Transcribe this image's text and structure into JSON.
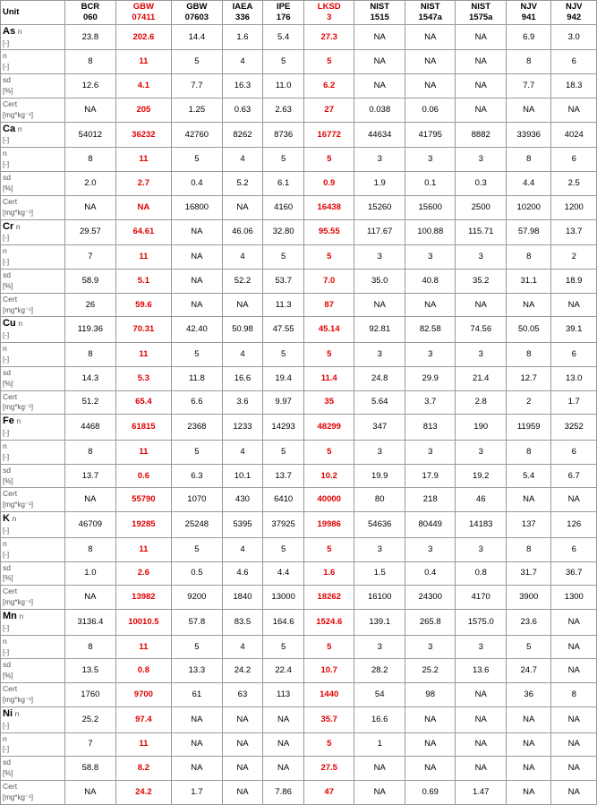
{
  "columns": [
    {
      "id": "unit",
      "label1": "",
      "label2": "Unit",
      "class": "col-unit"
    },
    {
      "id": "bcr060",
      "label1": "BCR",
      "label2": "060",
      "class": "col-bcr"
    },
    {
      "id": "gbw07411",
      "label1": "GBW",
      "label2": "07411",
      "class": "col-gbw1",
      "red": true
    },
    {
      "id": "gbw07603",
      "label1": "GBW",
      "label2": "07603",
      "class": "col-gbw2"
    },
    {
      "id": "iaea336",
      "label1": "IAEA",
      "label2": "336",
      "class": "col-iaea"
    },
    {
      "id": "ipe176",
      "label1": "IPE",
      "label2": "176",
      "class": "col-ipe"
    },
    {
      "id": "lksd3",
      "label1": "LKSD",
      "label2": "3",
      "class": "col-lksd",
      "red": true
    },
    {
      "id": "nist1515",
      "label1": "NIST",
      "label2": "1515",
      "class": "col-nist1"
    },
    {
      "id": "nist1547a",
      "label1": "NIST",
      "label2": "1547a",
      "class": "col-nist2"
    },
    {
      "id": "nist1575a",
      "label1": "NIST",
      "label2": "1575a",
      "class": "col-nist3"
    },
    {
      "id": "njv941",
      "label1": "NJV",
      "label2": "941",
      "class": "col-njv1"
    },
    {
      "id": "njv942",
      "label1": "NJV",
      "label2": "942",
      "class": "col-njv2"
    }
  ],
  "elements": [
    {
      "name": "As",
      "rows": [
        {
          "label": "n",
          "unit": "[-]",
          "values": [
            "23.8",
            "202.6",
            "14.4",
            "1.6",
            "5.4",
            "27.3",
            "NA",
            "NA",
            "NA",
            "6.9",
            "3.0"
          ],
          "redCols": [
            1,
            5
          ]
        },
        {
          "label": "n",
          "unit": "[-]",
          "values": [
            "8",
            "11",
            "5",
            "4",
            "5",
            "5",
            "NA",
            "NA",
            "NA",
            "8",
            "6"
          ],
          "redCols": [
            1,
            5
          ]
        },
        {
          "label": "sd",
          "unit": "[%]",
          "values": [
            "12.6",
            "4.1",
            "7.7",
            "16.3",
            "11.0",
            "6.2",
            "NA",
            "NA",
            "NA",
            "7.7",
            "18.3"
          ],
          "redCols": [
            1,
            5
          ]
        },
        {
          "label": "Cert",
          "unit": "[mg*kg⁻¹]",
          "values": [
            "NA",
            "205",
            "1.25",
            "0.63",
            "2.63",
            "27",
            "0.038",
            "0.06",
            "NA",
            "NA",
            "NA"
          ],
          "redCols": [
            1,
            5
          ]
        }
      ]
    },
    {
      "name": "Ca",
      "rows": [
        {
          "label": "n",
          "unit": "[-]",
          "values": [
            "54012",
            "36232",
            "42760",
            "8262",
            "8736",
            "16772",
            "44634",
            "41795",
            "8882",
            "33936",
            "4024"
          ],
          "redCols": [
            1,
            5
          ]
        },
        {
          "label": "n",
          "unit": "[-]",
          "values": [
            "8",
            "11",
            "5",
            "4",
            "5",
            "5",
            "3",
            "3",
            "3",
            "8",
            "6"
          ],
          "redCols": [
            1,
            5
          ]
        },
        {
          "label": "sd",
          "unit": "[%]",
          "values": [
            "2.0",
            "2.7",
            "0.4",
            "5.2",
            "6.1",
            "0.9",
            "1.9",
            "0.1",
            "0.3",
            "4.4",
            "2.5"
          ],
          "redCols": [
            1,
            5
          ]
        },
        {
          "label": "Cert",
          "unit": "[mg*kg⁻¹]",
          "values": [
            "NA",
            "NA",
            "16800",
            "NA",
            "4160",
            "16438",
            "15260",
            "15600",
            "2500",
            "10200",
            "1200"
          ],
          "redCols": [
            1,
            5
          ]
        }
      ]
    },
    {
      "name": "Cr",
      "rows": [
        {
          "label": "n",
          "unit": "[-]",
          "values": [
            "29.57",
            "64.61",
            "NA",
            "46.06",
            "32.80",
            "95.55",
            "117.67",
            "100.88",
            "115.71",
            "57.98",
            "13.7"
          ],
          "redCols": [
            1,
            5
          ]
        },
        {
          "label": "n",
          "unit": "[-]",
          "values": [
            "7",
            "11",
            "NA",
            "4",
            "5",
            "5",
            "3",
            "3",
            "3",
            "8",
            "2"
          ],
          "redCols": [
            1,
            5
          ]
        },
        {
          "label": "sd",
          "unit": "[%]",
          "values": [
            "58.9",
            "5.1",
            "NA",
            "52.2",
            "53.7",
            "7.0",
            "35.0",
            "40.8",
            "35.2",
            "31.1",
            "18.9"
          ],
          "redCols": [
            1,
            5
          ]
        },
        {
          "label": "Cert",
          "unit": "[mg*kg⁻¹]",
          "values": [
            "26",
            "59.6",
            "NA",
            "NA",
            "11.3",
            "87",
            "NA",
            "NA",
            "NA",
            "NA",
            "NA"
          ],
          "redCols": [
            1,
            5
          ]
        }
      ]
    },
    {
      "name": "Cu",
      "rows": [
        {
          "label": "n",
          "unit": "[-]",
          "values": [
            "119.36",
            "70.31",
            "42.40",
            "50.98",
            "47.55",
            "45.14",
            "92.81",
            "82.58",
            "74.56",
            "50.05",
            "39.1"
          ],
          "redCols": [
            1,
            5
          ]
        },
        {
          "label": "n",
          "unit": "[-]",
          "values": [
            "8",
            "11",
            "5",
            "4",
            "5",
            "5",
            "3",
            "3",
            "3",
            "8",
            "6"
          ],
          "redCols": [
            1,
            5
          ]
        },
        {
          "label": "sd",
          "unit": "[%]",
          "values": [
            "14.3",
            "5.3",
            "11.8",
            "16.6",
            "19.4",
            "11.4",
            "24.8",
            "29.9",
            "21.4",
            "12.7",
            "13.0"
          ],
          "redCols": [
            1,
            5
          ]
        },
        {
          "label": "Cert",
          "unit": "[mg*kg⁻¹]",
          "values": [
            "51.2",
            "65.4",
            "6.6",
            "3.6",
            "9.97",
            "35",
            "5.64",
            "3.7",
            "2.8",
            "2",
            "1.7"
          ],
          "redCols": [
            1,
            5
          ]
        }
      ]
    },
    {
      "name": "Fe",
      "rows": [
        {
          "label": "n",
          "unit": "[-]",
          "values": [
            "4468",
            "61815",
            "2368",
            "1233",
            "14293",
            "48299",
            "347",
            "813",
            "190",
            "11959",
            "3252"
          ],
          "redCols": [
            1,
            5
          ]
        },
        {
          "label": "n",
          "unit": "[-]",
          "values": [
            "8",
            "11",
            "5",
            "4",
            "5",
            "5",
            "3",
            "3",
            "3",
            "8",
            "6"
          ],
          "redCols": [
            1,
            5
          ]
        },
        {
          "label": "sd",
          "unit": "[%]",
          "values": [
            "13.7",
            "0.6",
            "6.3",
            "10.1",
            "13.7",
            "10.2",
            "19.9",
            "17.9",
            "19.2",
            "5.4",
            "6.7"
          ],
          "redCols": [
            1,
            5
          ]
        },
        {
          "label": "Cert",
          "unit": "[mg*kg⁻¹]",
          "values": [
            "NA",
            "55790",
            "1070",
            "430",
            "6410",
            "40000",
            "80",
            "218",
            "46",
            "NA",
            "NA"
          ],
          "redCols": [
            1,
            5
          ]
        }
      ]
    },
    {
      "name": "K",
      "rows": [
        {
          "label": "n",
          "unit": "[-]",
          "values": [
            "46709",
            "19285",
            "25248",
            "5395",
            "37925",
            "19986",
            "54636",
            "80449",
            "14183",
            "137",
            "126"
          ],
          "redCols": [
            1,
            5
          ]
        },
        {
          "label": "n",
          "unit": "[-]",
          "values": [
            "8",
            "11",
            "5",
            "4",
            "5",
            "5",
            "3",
            "3",
            "3",
            "8",
            "6"
          ],
          "redCols": [
            1,
            5
          ]
        },
        {
          "label": "sd",
          "unit": "[%]",
          "values": [
            "1.0",
            "2.6",
            "0.5",
            "4.6",
            "4.4",
            "1.6",
            "1.5",
            "0.4",
            "0.8",
            "31.7",
            "36.7"
          ],
          "redCols": [
            1,
            5
          ]
        },
        {
          "label": "Cert",
          "unit": "[mg*kg⁻¹]",
          "values": [
            "NA",
            "13982",
            "9200",
            "1840",
            "13000",
            "18262",
            "16100",
            "24300",
            "4170",
            "3900",
            "1300"
          ],
          "redCols": [
            1,
            5
          ]
        }
      ]
    },
    {
      "name": "Mn",
      "rows": [
        {
          "label": "n",
          "unit": "[-]",
          "values": [
            "3136.4",
            "10010.5",
            "57.8",
            "83.5",
            "164.6",
            "1524.6",
            "139.1",
            "265.8",
            "1575.0",
            "23.6",
            "NA"
          ],
          "redCols": [
            1,
            5
          ]
        },
        {
          "label": "n",
          "unit": "[-]",
          "values": [
            "8",
            "11",
            "5",
            "4",
            "5",
            "5",
            "3",
            "3",
            "3",
            "5",
            "NA"
          ],
          "redCols": [
            1,
            5
          ]
        },
        {
          "label": "sd",
          "unit": "[%]",
          "values": [
            "13.5",
            "0.8",
            "13.3",
            "24.2",
            "22.4",
            "10.7",
            "28.2",
            "25.2",
            "13.6",
            "24.7",
            "NA"
          ],
          "redCols": [
            1,
            5
          ]
        },
        {
          "label": "Cert",
          "unit": "[mg*kg⁻¹]",
          "values": [
            "1760",
            "9700",
            "61",
            "63",
            "113",
            "1440",
            "54",
            "98",
            "NA",
            "36",
            "8"
          ],
          "redCols": [
            1,
            5
          ]
        }
      ]
    },
    {
      "name": "Ni",
      "rows": [
        {
          "label": "n",
          "unit": "[-]",
          "values": [
            "25.2",
            "97.4",
            "NA",
            "NA",
            "NA",
            "35.7",
            "16.6",
            "NA",
            "NA",
            "NA",
            "NA"
          ],
          "redCols": [
            1,
            5
          ]
        },
        {
          "label": "n",
          "unit": "[-]",
          "values": [
            "7",
            "11",
            "NA",
            "NA",
            "NA",
            "5",
            "1",
            "NA",
            "NA",
            "NA",
            "NA"
          ],
          "redCols": [
            1,
            5
          ]
        },
        {
          "label": "sd",
          "unit": "[%]",
          "values": [
            "58.8",
            "8.2",
            "NA",
            "NA",
            "NA",
            "27.5",
            "NA",
            "NA",
            "NA",
            "NA",
            "NA"
          ],
          "redCols": [
            1,
            5
          ]
        },
        {
          "label": "Cert",
          "unit": "[mg*kg⁻¹]",
          "values": [
            "NA",
            "24.2",
            "1.7",
            "NA",
            "7.86",
            "47",
            "NA",
            "0.69",
            "1.47",
            "NA",
            "NA"
          ],
          "redCols": [
            1,
            5
          ]
        }
      ]
    }
  ],
  "rowTypeLabels": [
    "n",
    "n",
    "sd",
    "Cert"
  ],
  "rowUnitLabels": [
    "[-]",
    "[-]",
    "[%]",
    "[mg*kg⁻¹]"
  ]
}
